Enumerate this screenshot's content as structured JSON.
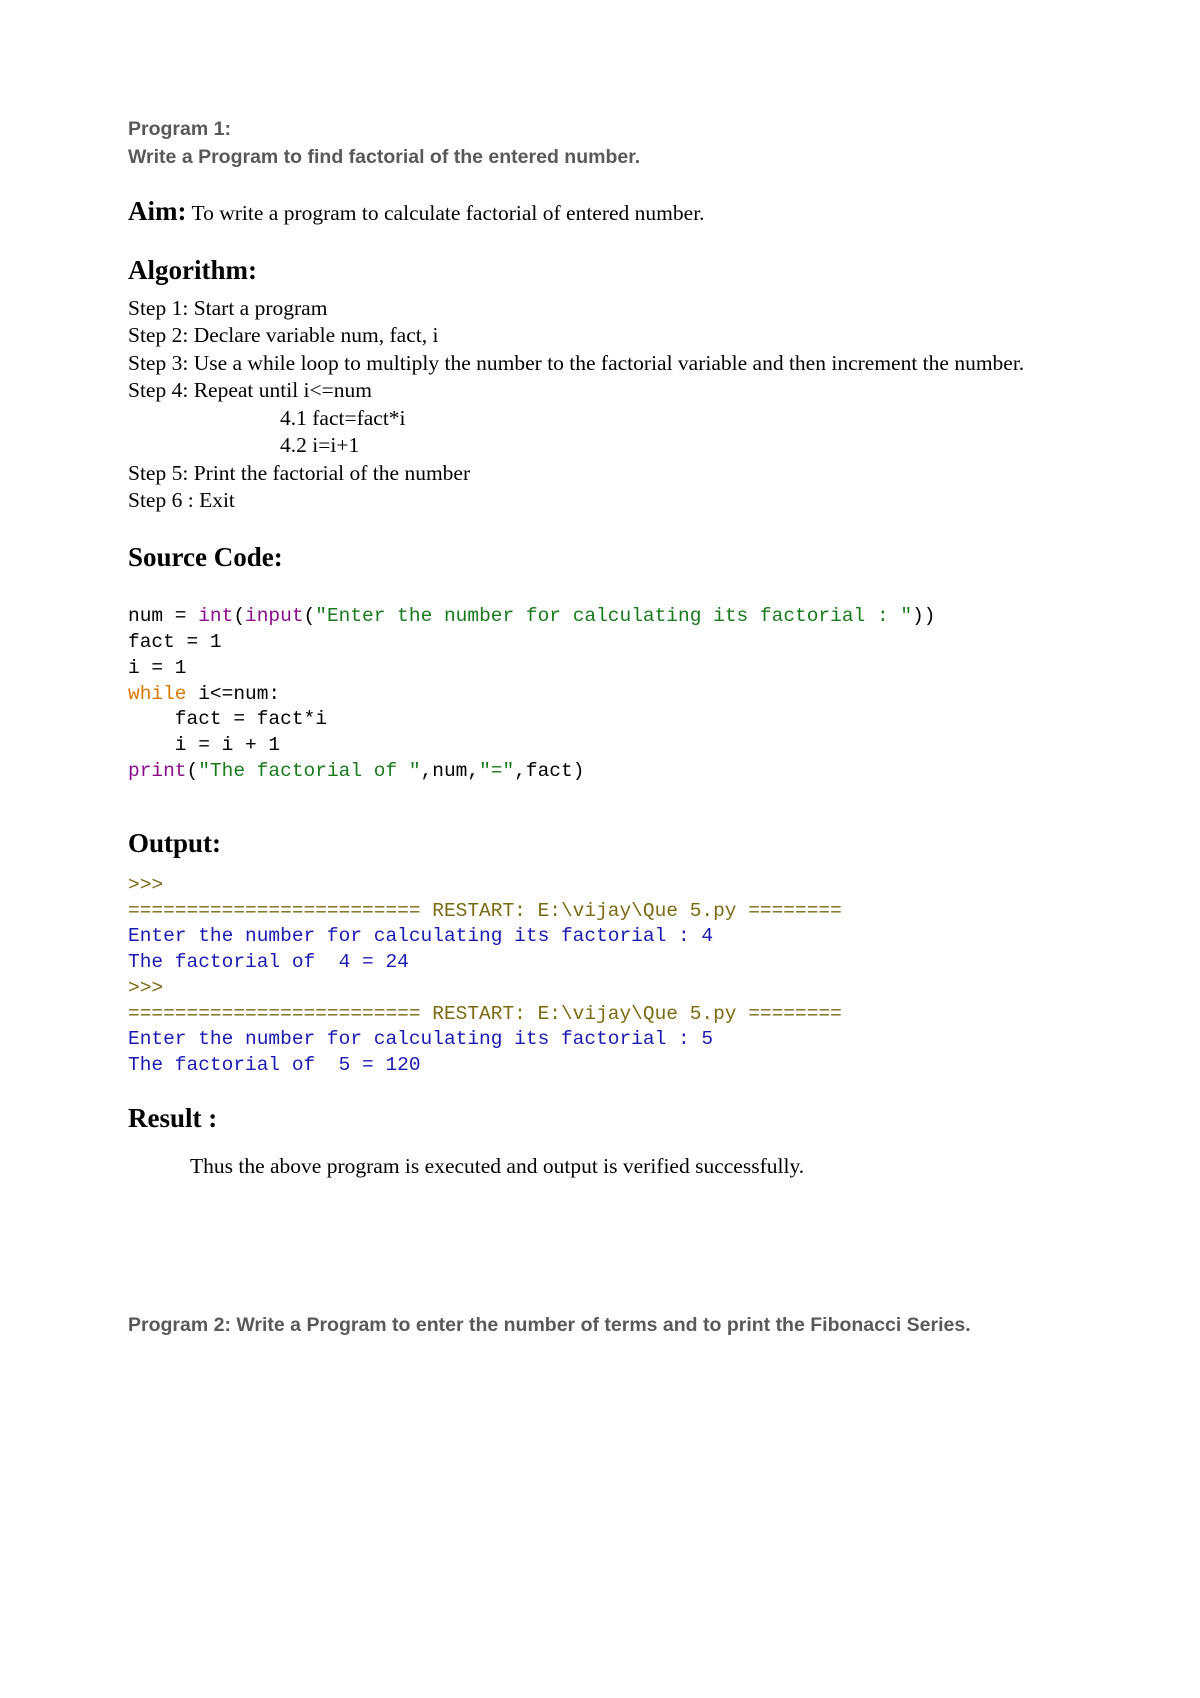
{
  "program1": {
    "header_line1": "Program 1:",
    "header_line2": " Write a Program to find factorial of the entered number.",
    "aim_label": "Aim:",
    "aim_text": "   To write a program to calculate factorial of entered number.",
    "algorithm_title": "Algorithm:",
    "steps": {
      "s1": "Step 1: Start a program",
      "s2": "Step 2: Declare variable num, fact, i",
      "s3": "Step 3: Use a while loop to multiply the number to the factorial variable and then increment the number.",
      "s4": "Step 4: Repeat until i<=num",
      "s4a": "4.1 fact=fact*i",
      "s4b": "4.2 i=i+1",
      "s5": "Step 5: Print the factorial of the number",
      "s6": "Step 6 : Exit"
    },
    "source_title": "Source Code:",
    "code": {
      "l1_num": "num = ",
      "l1_int": "int",
      "l1_paren1": "(",
      "l1_input": "input",
      "l1_paren2": "(",
      "l1_str": "\"Enter the number for calculating its factorial : \"",
      "l1_close": "))",
      "l2": "fact = 1",
      "l3": "i = 1",
      "l4_while": "while",
      "l4_cond": " i<=num:",
      "l5": "    fact = fact*i",
      "l6": "    i = i + 1",
      "l7_print": "print",
      "l7_paren1": "(",
      "l7_str1": "\"The factorial of \"",
      "l7_mid": ",num,",
      "l7_str2": "\"=\"",
      "l7_end": ",fact)"
    },
    "output_title": "Output:",
    "output": {
      "l1": ">>>",
      "l2": "========================= RESTART: E:\\vijay\\Que 5.py ========",
      "l3": "Enter the number for calculating its factorial : 4",
      "l4": "The factorial of  4 = 24",
      "l5": ">>>",
      "l6": "========================= RESTART: E:\\vijay\\Que 5.py ========",
      "l7": "Enter the number for calculating its factorial : 5",
      "l8": "The factorial of  5 = 120"
    },
    "result_title": "Result :",
    "result_text": "Thus the above program is executed and output is verified successfully."
  },
  "program2": {
    "header": "Program 2: Write a Program to enter the number of terms and to print the Fibonacci Series."
  }
}
